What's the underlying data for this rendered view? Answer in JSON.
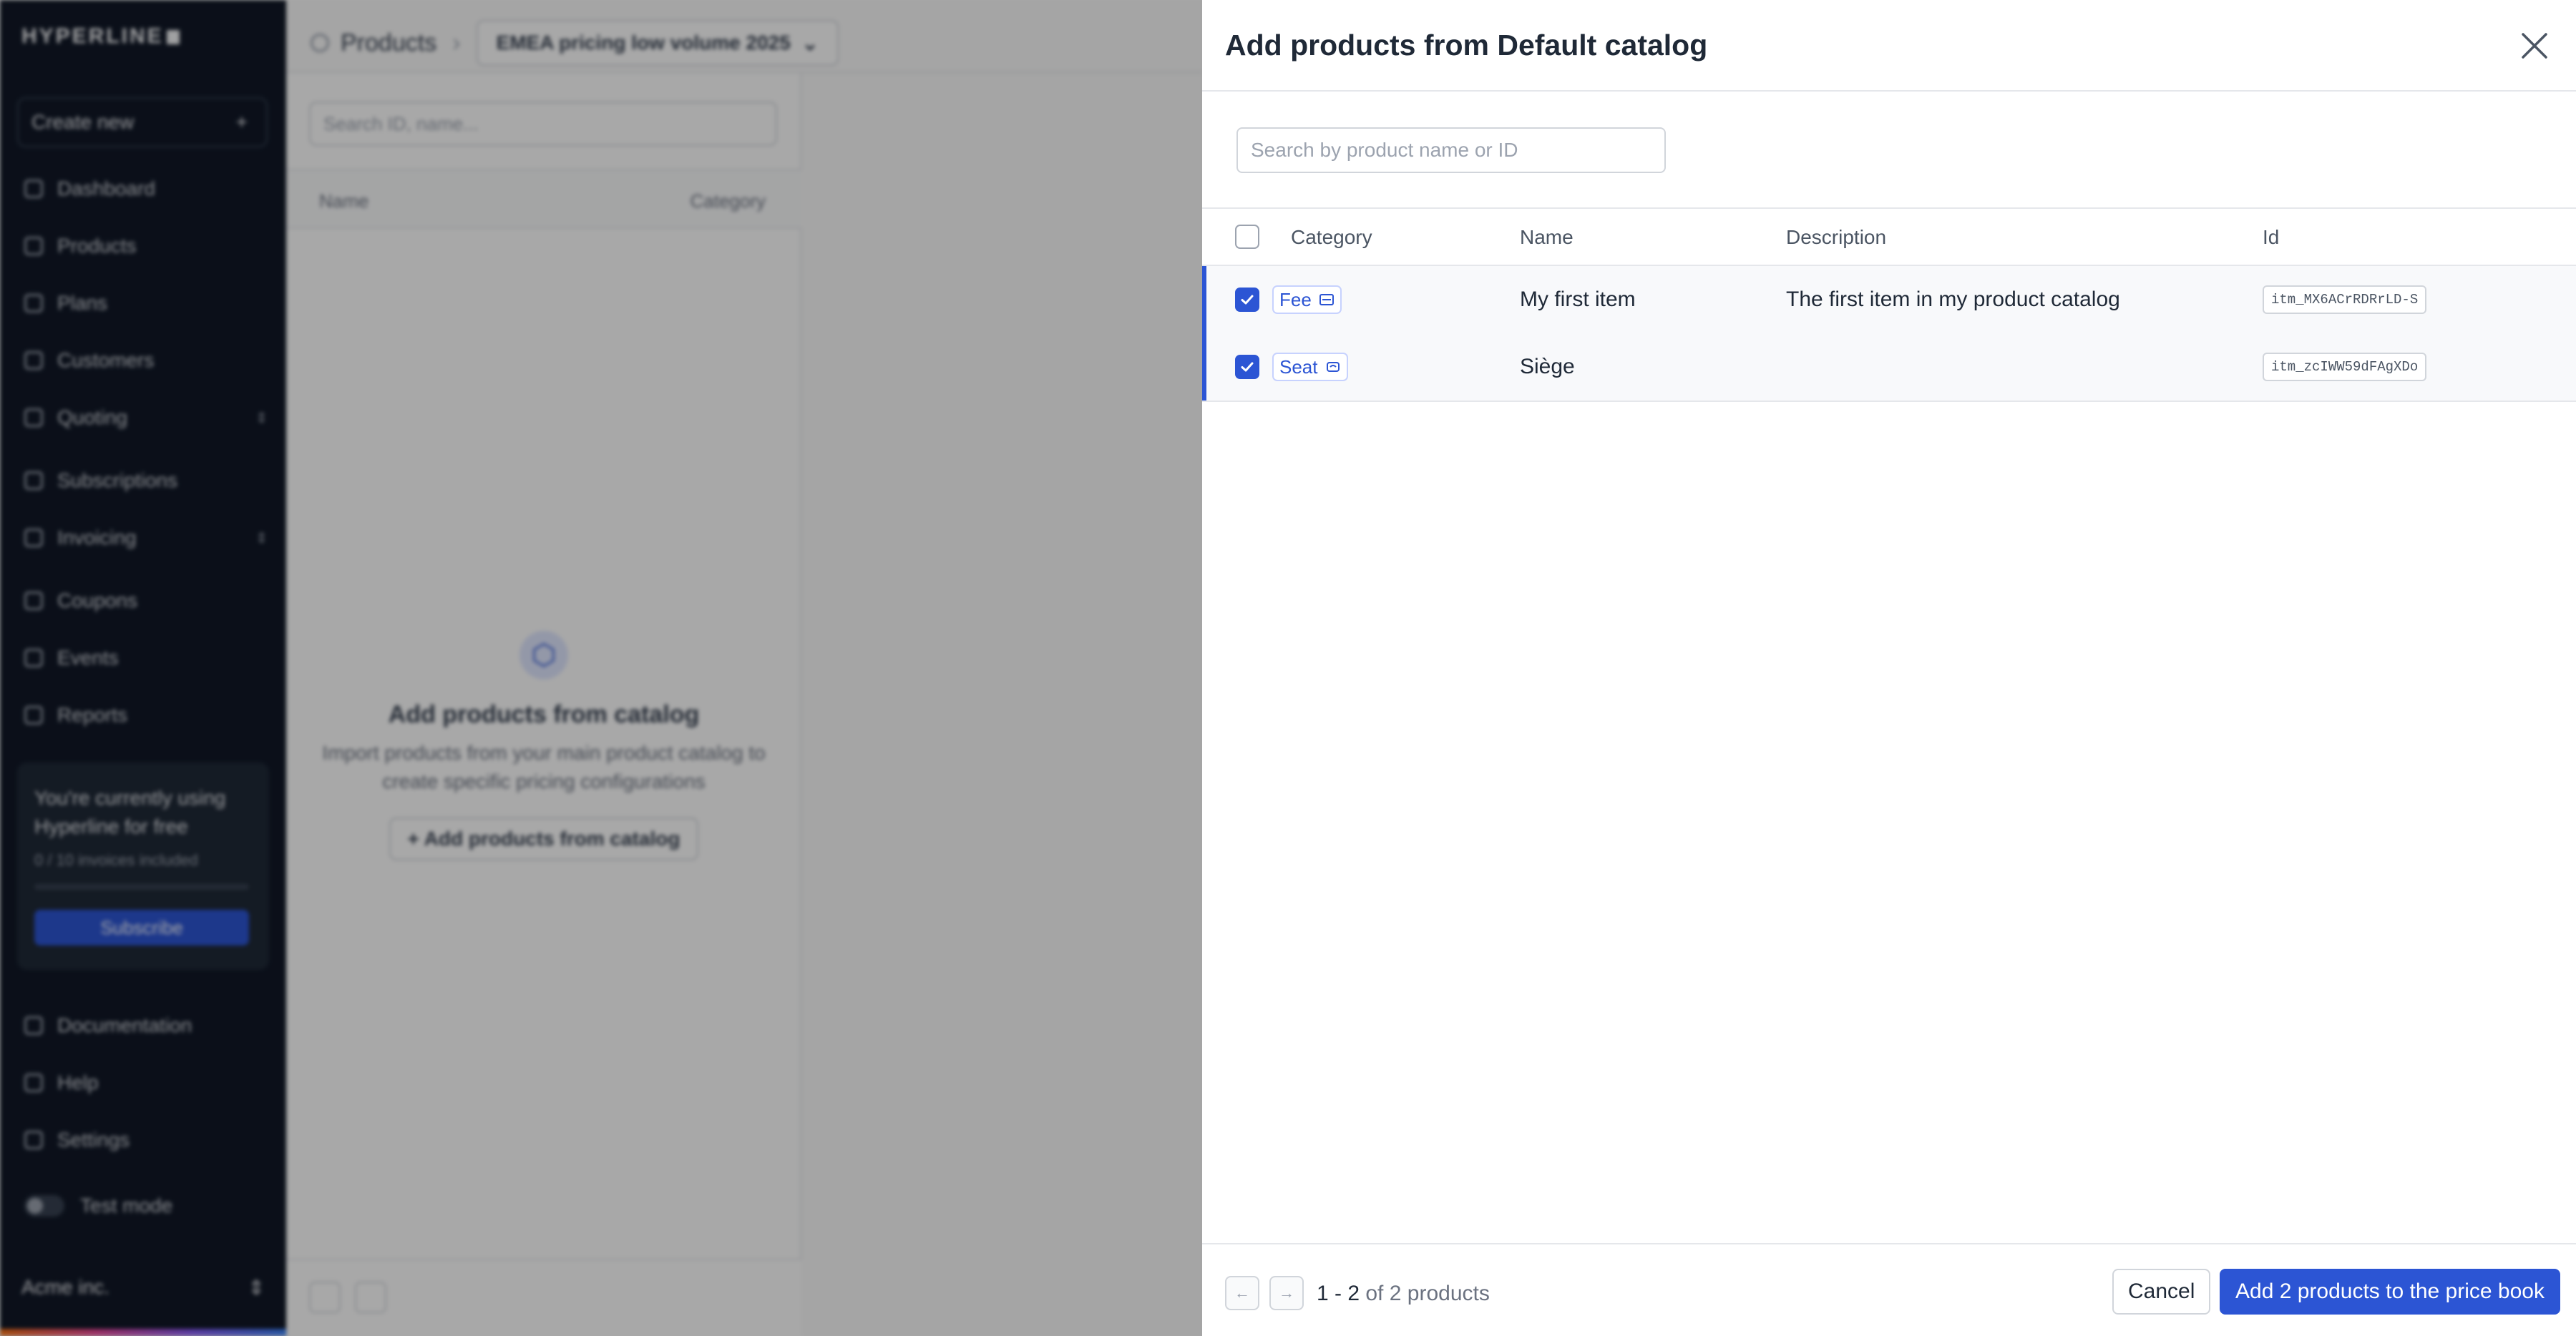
{
  "background": {
    "logo": "HYPERLINE",
    "create_new": "Create new",
    "nav": [
      {
        "label": "Dashboard",
        "icon": "chart-icon"
      },
      {
        "label": "Products",
        "icon": "cube-icon"
      },
      {
        "label": "Plans",
        "icon": "book-icon"
      },
      {
        "label": "Customers",
        "icon": "users-icon"
      },
      {
        "label": "Quoting",
        "icon": "quote-icon"
      },
      {
        "label": "Subscriptions",
        "icon": "refresh-icon"
      },
      {
        "label": "Invoicing",
        "icon": "invoice-icon"
      },
      {
        "label": "Coupons",
        "icon": "tag-icon"
      },
      {
        "label": "Events",
        "icon": "database-icon"
      },
      {
        "label": "Reports",
        "icon": "bar-chart-icon"
      }
    ],
    "promo": {
      "text": "You're currently using Hyperline for free",
      "usage": "0 / 10 invoices included",
      "subscribe": "Subscribe"
    },
    "bottom_nav": [
      {
        "label": "Documentation",
        "icon": "book-open-icon"
      },
      {
        "label": "Help",
        "icon": "help-icon"
      },
      {
        "label": "Settings",
        "icon": "gear-icon"
      }
    ],
    "test_mode": "Test mode",
    "account": "Acme inc.",
    "breadcrumb": {
      "section": "Products",
      "price_book": "EMEA pricing low volume 2025"
    },
    "list": {
      "search_placeholder": "Search ID, name...",
      "col_name": "Name",
      "col_category": "Category",
      "empty_title": "Add products from catalog",
      "empty_desc": "Import products from your main product catalog to create specific pricing configurations",
      "empty_button": "Add products from catalog"
    }
  },
  "modal": {
    "title": "Add products from Default catalog",
    "search_placeholder": "Search by product name or ID",
    "columns": {
      "category": "Category",
      "name": "Name",
      "description": "Description",
      "id": "Id"
    },
    "rows": [
      {
        "checked": true,
        "category": "Fee",
        "category_icon": "fee-icon",
        "name": "My first item",
        "description": "The first item in my product catalog",
        "id": "itm_MX6ACrRDRrLD-S"
      },
      {
        "checked": true,
        "category": "Seat",
        "category_icon": "seat-icon",
        "name": "Siège",
        "description": "",
        "id": "itm_zcIWW59dFAgXDo"
      }
    ],
    "pagination": {
      "range": "1 - 2",
      "of": "of",
      "total": "2",
      "unit": "products"
    },
    "cancel": "Cancel",
    "submit": "Add 2 products to the price book",
    "accent_color": "#2c55d4"
  }
}
